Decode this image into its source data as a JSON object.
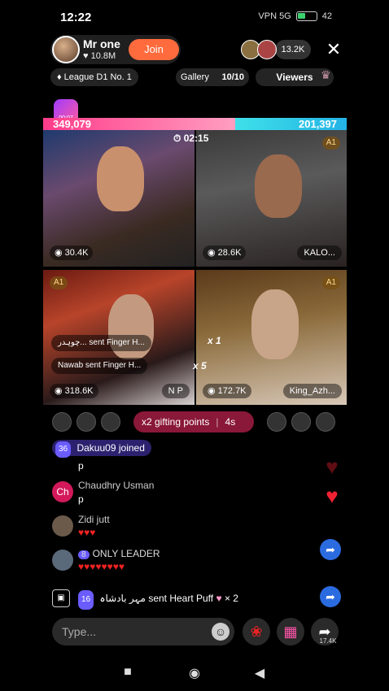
{
  "status_bar": {
    "time": "12:22",
    "icons_text": "VPN  5G",
    "battery": "42"
  },
  "header": {
    "host_name": "Mr one",
    "host_likes": "10.8M",
    "join_label": "Join",
    "viewer_count": "13.2K",
    "close_icon": "close-icon"
  },
  "subheader": {
    "league": "League D1 No. 1",
    "gallery_label": "Gallery",
    "gallery_count": "10/10",
    "viewers_label": "Viewers"
  },
  "battle": {
    "badge_time": "00:07",
    "score_left": "349,079",
    "score_right": "201,397",
    "clock": "02:15",
    "left_share": 0.634,
    "left_color": "#ff3c8a",
    "right_color": "#24b3e6"
  },
  "tiles": [
    {
      "count": "30.4K",
      "name": ""
    },
    {
      "count": "28.6K",
      "name": "KALO...",
      "tier": "A1"
    },
    {
      "count": "318.6K",
      "name": "N P",
      "tier": "A1"
    },
    {
      "count": "172.7K",
      "name": "King_Azh...",
      "tier": "A1"
    }
  ],
  "gift_overlays": {
    "line1": "چوہدر... sent Finger H...",
    "line2_name": "Nawab",
    "line2_text": "sent Finger H...",
    "line2_mult": "x 5",
    "tile4_mult": "x 1"
  },
  "gifting": {
    "label": "x2 gifting points",
    "timer": "4s"
  },
  "join_msg": {
    "level": "36",
    "user": "Dakuu09",
    "text": "joined"
  },
  "chat": [
    {
      "name": "",
      "text": "p"
    },
    {
      "avatar_text": "Ch",
      "name": "Chaudhry Usman",
      "text": "p"
    },
    {
      "name": "Zidi jutt",
      "text": "♥♥♥"
    },
    {
      "level": "8",
      "name": "ONLY LEADER",
      "text": "♥♥♥♥♥♥♥♥"
    }
  ],
  "gift_bar": {
    "level": "16",
    "user": "مہر بادشاہ",
    "text": "sent Heart Puff",
    "mult": "× 2"
  },
  "input": {
    "placeholder": "Type...",
    "share_count": "17.4K"
  },
  "colors": {
    "accent": "#ff6b3d",
    "gifting": "#8a1838",
    "heart": "#e22233",
    "share": "#2b6be0"
  }
}
